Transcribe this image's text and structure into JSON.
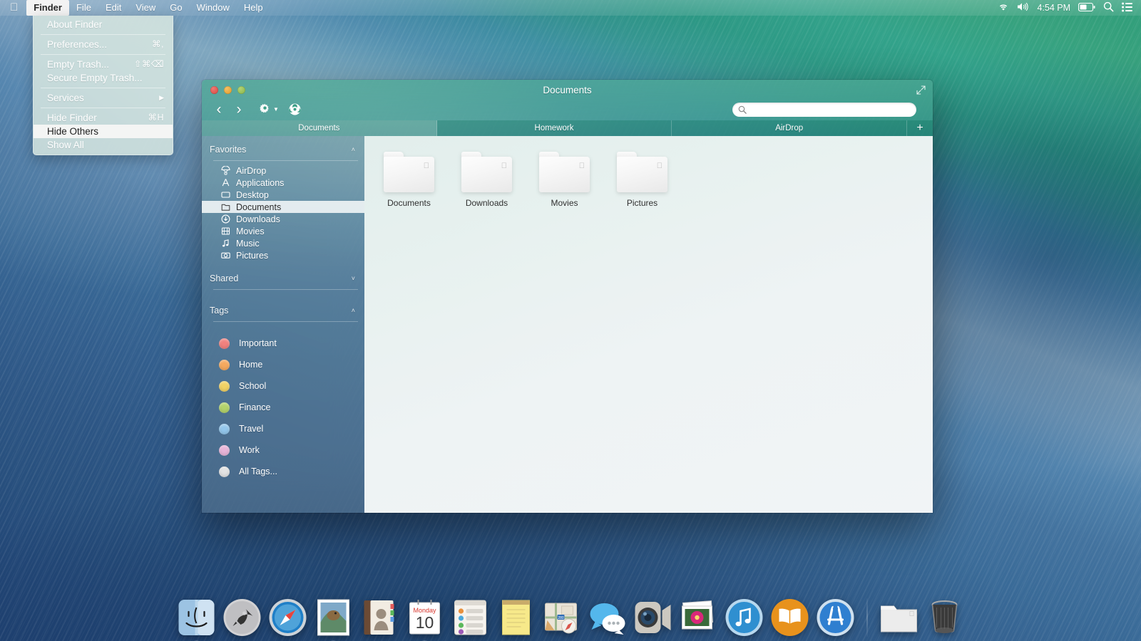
{
  "menubar": {
    "apple_icon": "apple-logo-icon",
    "items": [
      {
        "label": "Finder",
        "bold": true,
        "active": true
      },
      {
        "label": "File",
        "bold": false,
        "active": false
      },
      {
        "label": "Edit",
        "bold": false,
        "active": false
      },
      {
        "label": "View",
        "bold": false,
        "active": false
      },
      {
        "label": "Go",
        "bold": false,
        "active": false
      },
      {
        "label": "Window",
        "bold": false,
        "active": false
      },
      {
        "label": "Help",
        "bold": false,
        "active": false
      }
    ],
    "status": {
      "wifi_icon": "wifi-icon",
      "volume_icon": "volume-icon",
      "clock": "4:54 PM",
      "battery_icon": "battery-icon",
      "search_icon": "spotlight-search-icon",
      "notification_icon": "notification-center-icon"
    }
  },
  "finder_menu": {
    "title": "Finder",
    "items": [
      {
        "label": "About Finder",
        "shortcut": "",
        "type": "item",
        "highlighted": false
      },
      {
        "type": "separator"
      },
      {
        "label": "Preferences...",
        "shortcut": "⌘,",
        "type": "item",
        "highlighted": false
      },
      {
        "type": "separator"
      },
      {
        "label": "Empty Trash...",
        "shortcut": "⇧⌘⌫",
        "type": "item",
        "highlighted": false
      },
      {
        "label": "Secure Empty Trash...",
        "shortcut": "",
        "type": "item",
        "highlighted": false
      },
      {
        "type": "separator"
      },
      {
        "label": "Services",
        "shortcut": "▶",
        "type": "submenu",
        "highlighted": false
      },
      {
        "type": "separator"
      },
      {
        "label": "Hide Finder",
        "shortcut": "⌘H",
        "type": "item",
        "highlighted": false
      },
      {
        "label": "Hide Others",
        "shortcut": "",
        "type": "item",
        "highlighted": true
      },
      {
        "label": "Show All",
        "shortcut": "",
        "type": "item",
        "highlighted": false
      }
    ]
  },
  "window": {
    "title": "Documents",
    "traffic_lights": {
      "close": "#d8443c",
      "minimize": "#df9826",
      "zoom": "#85b247"
    },
    "expand_icon": "expand-window-icon",
    "toolbar": {
      "back_label": "‹",
      "forward_label": "›",
      "action_label": "gear-action-menu",
      "burn_label": "burn-disc-icon"
    },
    "search": {
      "placeholder": "",
      "value": "",
      "icon": "search-icon"
    },
    "tabs": [
      {
        "label": "Documents",
        "active": true
      },
      {
        "label": "Homework",
        "active": false
      },
      {
        "label": "AirDrop",
        "active": false
      }
    ],
    "add_tab_label": "+"
  },
  "sidebar": {
    "sections": [
      {
        "title": "Favorites",
        "collapsed": false,
        "chevron": "˄",
        "items": [
          {
            "label": "AirDrop",
            "icon": "airdrop-parachute-icon",
            "glyph": "☂",
            "selected": false
          },
          {
            "label": "Applications",
            "icon": "applications-icon",
            "glyph": "✈",
            "selected": false
          },
          {
            "label": "Desktop",
            "icon": "desktop-monitor-icon",
            "glyph": "▭",
            "selected": false
          },
          {
            "label": "Documents",
            "icon": "documents-folder-icon",
            "glyph": "◱",
            "selected": true
          },
          {
            "label": "Downloads",
            "icon": "downloads-arrow-icon",
            "glyph": "⬇",
            "selected": false
          },
          {
            "label": "Movies",
            "icon": "movies-film-icon",
            "glyph": "▦",
            "selected": false
          },
          {
            "label": "Music",
            "icon": "music-note-icon",
            "glyph": "♫",
            "selected": false
          },
          {
            "label": "Pictures",
            "icon": "pictures-camera-icon",
            "glyph": "▣",
            "selected": false
          }
        ]
      },
      {
        "title": "Shared",
        "collapsed": true,
        "chevron": "˅",
        "items": []
      },
      {
        "title": "Tags",
        "collapsed": false,
        "chevron": "˄",
        "items": []
      }
    ],
    "tags": [
      {
        "label": "Important",
        "color": "#f0817e"
      },
      {
        "label": "Home",
        "color": "#f5a95e"
      },
      {
        "label": "School",
        "color": "#f2d264"
      },
      {
        "label": "Finance",
        "color": "#b3d36a"
      },
      {
        "label": "Travel",
        "color": "#93c7ec"
      },
      {
        "label": "Work",
        "color": "#e8b4d8"
      },
      {
        "label": "All Tags...",
        "color": "#e3e3e3"
      }
    ]
  },
  "content": {
    "files": [
      {
        "name": "Documents",
        "type": "folder"
      },
      {
        "name": "Downloads",
        "type": "folder"
      },
      {
        "name": "Movies",
        "type": "folder"
      },
      {
        "name": "Pictures",
        "type": "folder"
      }
    ]
  },
  "dock": {
    "items": [
      {
        "name": "Finder",
        "icon": "finder-icon",
        "running": true
      },
      {
        "name": "Launchpad",
        "icon": "launchpad-rocket-icon",
        "running": false
      },
      {
        "name": "Safari",
        "icon": "safari-compass-icon",
        "running": false
      },
      {
        "name": "Mail",
        "icon": "mail-stamp-icon",
        "running": true
      },
      {
        "name": "Contacts",
        "icon": "contacts-book-icon",
        "running": false
      },
      {
        "name": "Calendar",
        "icon": "calendar-icon",
        "running": true,
        "day": "Monday",
        "date": "10"
      },
      {
        "name": "Reminders",
        "icon": "reminders-list-icon",
        "running": false
      },
      {
        "name": "Notes",
        "icon": "notes-pad-icon",
        "running": false
      },
      {
        "name": "Maps",
        "icon": "maps-icon",
        "running": false
      },
      {
        "name": "Messages",
        "icon": "messages-bubble-icon",
        "running": false
      },
      {
        "name": "FaceTime",
        "icon": "facetime-camera-icon",
        "running": false
      },
      {
        "name": "iPhoto",
        "icon": "iphoto-flower-icon",
        "running": false
      },
      {
        "name": "iTunes",
        "icon": "itunes-note-icon",
        "running": false
      },
      {
        "name": "iBooks",
        "icon": "ibooks-book-icon",
        "running": false
      },
      {
        "name": "App Store",
        "icon": "app-store-icon",
        "running": false
      }
    ],
    "right_items": [
      {
        "name": "Documents",
        "icon": "dock-folder-icon"
      },
      {
        "name": "Trash",
        "icon": "trash-can-icon"
      }
    ]
  }
}
